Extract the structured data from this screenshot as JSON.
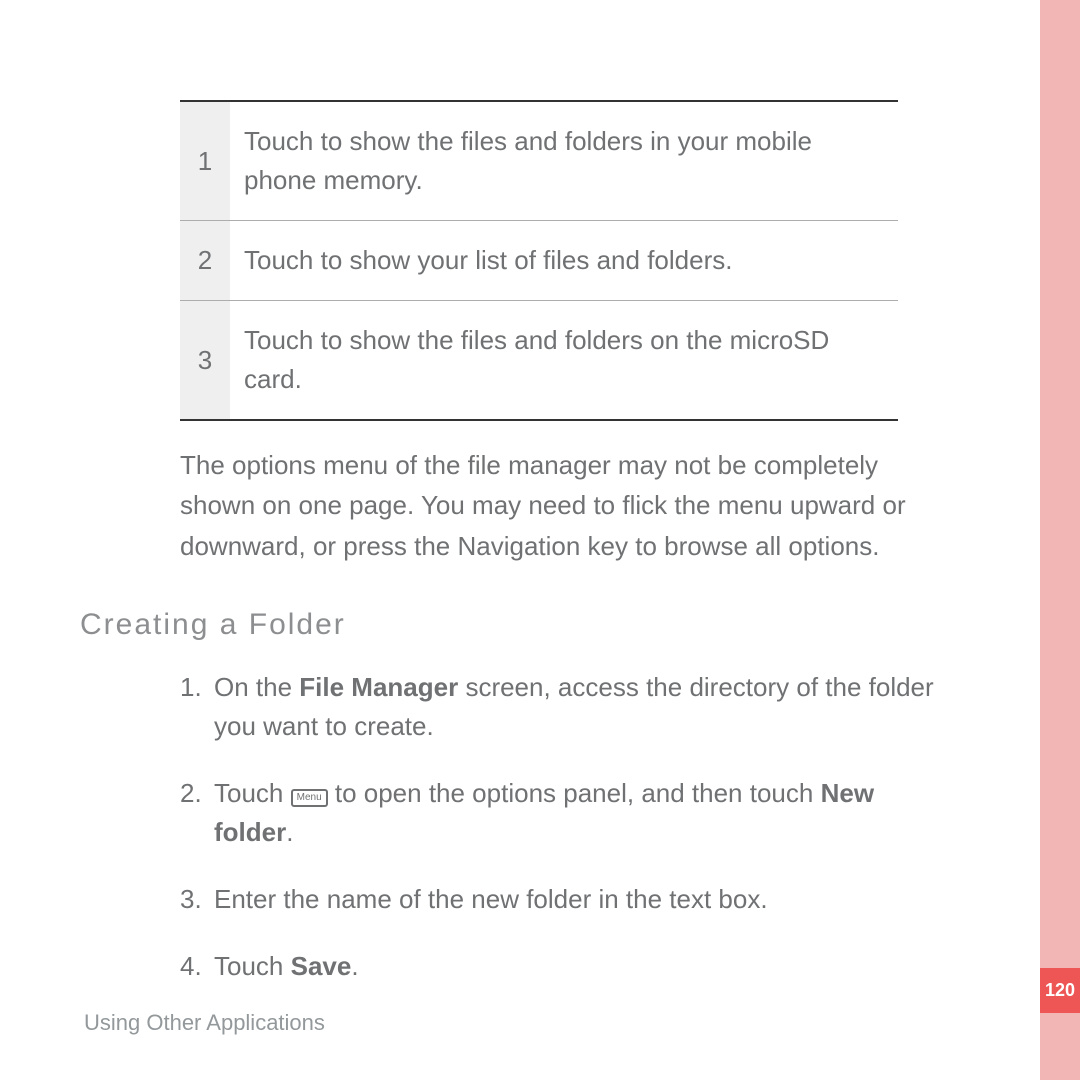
{
  "legend": {
    "rows": [
      {
        "num": "1",
        "desc": "Touch to show the files and folders in your mobile phone memory."
      },
      {
        "num": "2",
        "desc": "Touch to show your list of files and folders."
      },
      {
        "num": "3",
        "desc": "Touch to show the files and folders on the microSD card."
      }
    ]
  },
  "note": "The options menu of the file manager may not be completely shown on one page. You may need to flick the menu upward or downward, or press the Navigation key to browse all options.",
  "section_heading": "Creating  a  Folder",
  "steps": {
    "s1": {
      "num": "1.",
      "pre": "On the ",
      "bold": "File Manager",
      "post": " screen, access the directory of the folder you want to create."
    },
    "s2": {
      "num": "2.",
      "pre": "Touch ",
      "key": "Menu",
      "mid": " to open the options panel, and then touch ",
      "bold": "New folder",
      "post": "."
    },
    "s3": {
      "num": "3.",
      "text": "Enter the name of the new folder in the text box."
    },
    "s4": {
      "num": "4.",
      "pre": "Touch ",
      "bold": "Save",
      "post": "."
    }
  },
  "footer": "Using Other Applications",
  "page_number": "120"
}
